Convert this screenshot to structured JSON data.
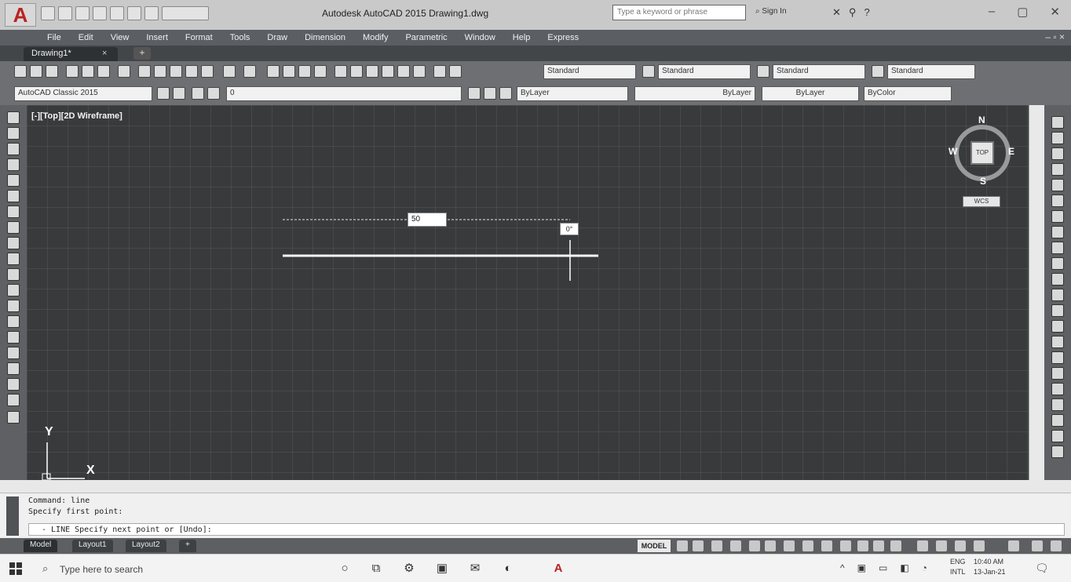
{
  "app": {
    "logo": "A",
    "title": "Autodesk AutoCAD 2015   Drawing1.dwg",
    "search_placeholder": "Type a keyword or phrase",
    "sign_in": "Sign In",
    "help": "?"
  },
  "menu": [
    "File",
    "Edit",
    "View",
    "Insert",
    "Format",
    "Tools",
    "Draw",
    "Dimension",
    "Modify",
    "Parametric",
    "Window",
    "Help",
    "Express"
  ],
  "tabs": {
    "document": "Drawing1*",
    "close": "×",
    "new_tab": "+"
  },
  "toolbars": {
    "text_style": "Standard",
    "dim_style": "Standard",
    "table_style": "Standard",
    "multileader_style": "Standard",
    "workspace": "AutoCAD Classic 2015",
    "layer": "0",
    "color": "ByLayer",
    "linetype": "ByLayer",
    "lineweight": "ByLayer",
    "plotstyle": "ByColor"
  },
  "viewport": {
    "label": "[-][Top][2D Wireframe]",
    "viewcube": {
      "n": "N",
      "s": "S",
      "e": "E",
      "w": "W",
      "top": "TOP",
      "wcs": "WCS"
    },
    "length_input": "50",
    "angle_tip": "0°",
    "ucs_y": "Y",
    "ucs_x": "X"
  },
  "command": {
    "history": [
      "Command:  line",
      "Specify first point:"
    ],
    "prompt": "- LINE Specify next point or [Undo]:"
  },
  "layout_tabs": [
    "Model",
    "Layout1",
    "Layout2",
    "+"
  ],
  "status": {
    "model": "MODEL"
  },
  "taskbar": {
    "search": "Type here to search",
    "lang": [
      "ENG",
      "INTL"
    ],
    "time": "10:40 AM",
    "date": "13-Jan-21"
  }
}
